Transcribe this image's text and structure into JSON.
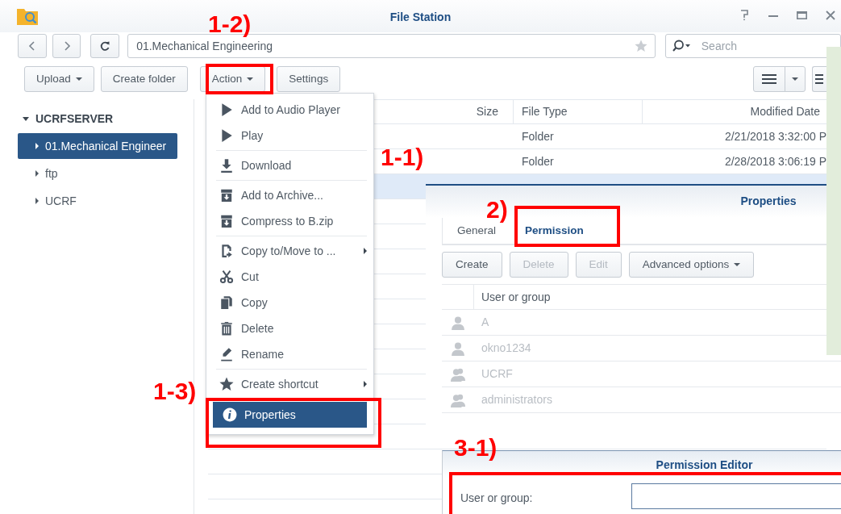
{
  "window": {
    "title": "File Station"
  },
  "nav": {
    "path": "01.Mechanical Engineering",
    "search_placeholder": "Search"
  },
  "toolbar": [
    {
      "label": "Upload",
      "caret": true
    },
    {
      "label": "Create folder",
      "caret": false
    },
    {
      "label": "Action",
      "caret": true
    },
    {
      "label": "Settings",
      "caret": false
    }
  ],
  "sidebar": {
    "root": {
      "label": "UCRFSERVER",
      "expanded": true,
      "children": [
        {
          "label": "01.Mechanical Engineer",
          "selected": true,
          "expanded": false
        },
        {
          "label": "ftp",
          "selected": false,
          "expanded": false
        },
        {
          "label": "UCRF",
          "selected": false,
          "expanded": false
        }
      ]
    }
  },
  "file_list": {
    "columns": [
      "Size",
      "File Type",
      "Modified Date"
    ],
    "rows": [
      {
        "file_type": "Folder",
        "modified": "2/21/2018 3:32:00 P",
        "selected": false
      },
      {
        "file_type": "Folder",
        "modified": "2/28/2018 3:06:19 P",
        "selected": false
      },
      {
        "selected": true
      }
    ]
  },
  "context_menu": {
    "groups": [
      [
        {
          "label": "Add to Audio Player",
          "kind": "play",
          "submenu": false,
          "selected": false
        },
        {
          "label": "Play",
          "kind": "play",
          "submenu": false,
          "selected": false
        }
      ],
      [
        {
          "label": "Download",
          "kind": "download",
          "submenu": false,
          "selected": false
        }
      ],
      [
        {
          "label": "Add to Archive...",
          "kind": "archive",
          "submenu": false,
          "selected": false
        },
        {
          "label": "Compress to B.zip",
          "kind": "archive",
          "submenu": false,
          "selected": false
        }
      ],
      [
        {
          "label": "Copy to/Move to ...",
          "kind": "copymove",
          "submenu": true,
          "selected": false
        },
        {
          "label": "Cut",
          "kind": "cut",
          "submenu": false,
          "selected": false
        },
        {
          "label": "Copy",
          "kind": "copy",
          "submenu": false,
          "selected": false
        },
        {
          "label": "Delete",
          "kind": "delete",
          "submenu": false,
          "selected": false
        },
        {
          "label": "Rename",
          "kind": "rename",
          "submenu": false,
          "selected": false
        }
      ],
      [
        {
          "label": "Create shortcut",
          "kind": "star",
          "submenu": true,
          "selected": false
        }
      ],
      [
        {
          "label": "Properties",
          "kind": "info",
          "submenu": false,
          "selected": true
        }
      ]
    ]
  },
  "properties": {
    "title": "Properties",
    "tabs": [
      {
        "label": "General",
        "selected": false
      },
      {
        "label": "Permission",
        "selected": true
      }
    ],
    "buttons": [
      {
        "label": "Create",
        "disabled": false,
        "caret": false
      },
      {
        "label": "Delete",
        "disabled": true,
        "caret": false
      },
      {
        "label": "Edit",
        "disabled": true,
        "caret": false
      },
      {
        "label": "Advanced options",
        "disabled": false,
        "caret": true
      }
    ],
    "column": "User or group",
    "rows": [
      {
        "name": "A",
        "kind": "user"
      },
      {
        "name": "okno1234",
        "kind": "user"
      },
      {
        "name": "UCRF",
        "kind": "group"
      },
      {
        "name": "administrators",
        "kind": "group"
      }
    ]
  },
  "permission_editor": {
    "title": "Permission Editor",
    "field_label": "User or group:"
  },
  "annotations": [
    {
      "label": "1-2)"
    },
    {
      "label": "1-1)"
    },
    {
      "label": "2)"
    },
    {
      "label": "1-3)"
    },
    {
      "label": "3-1)"
    }
  ]
}
